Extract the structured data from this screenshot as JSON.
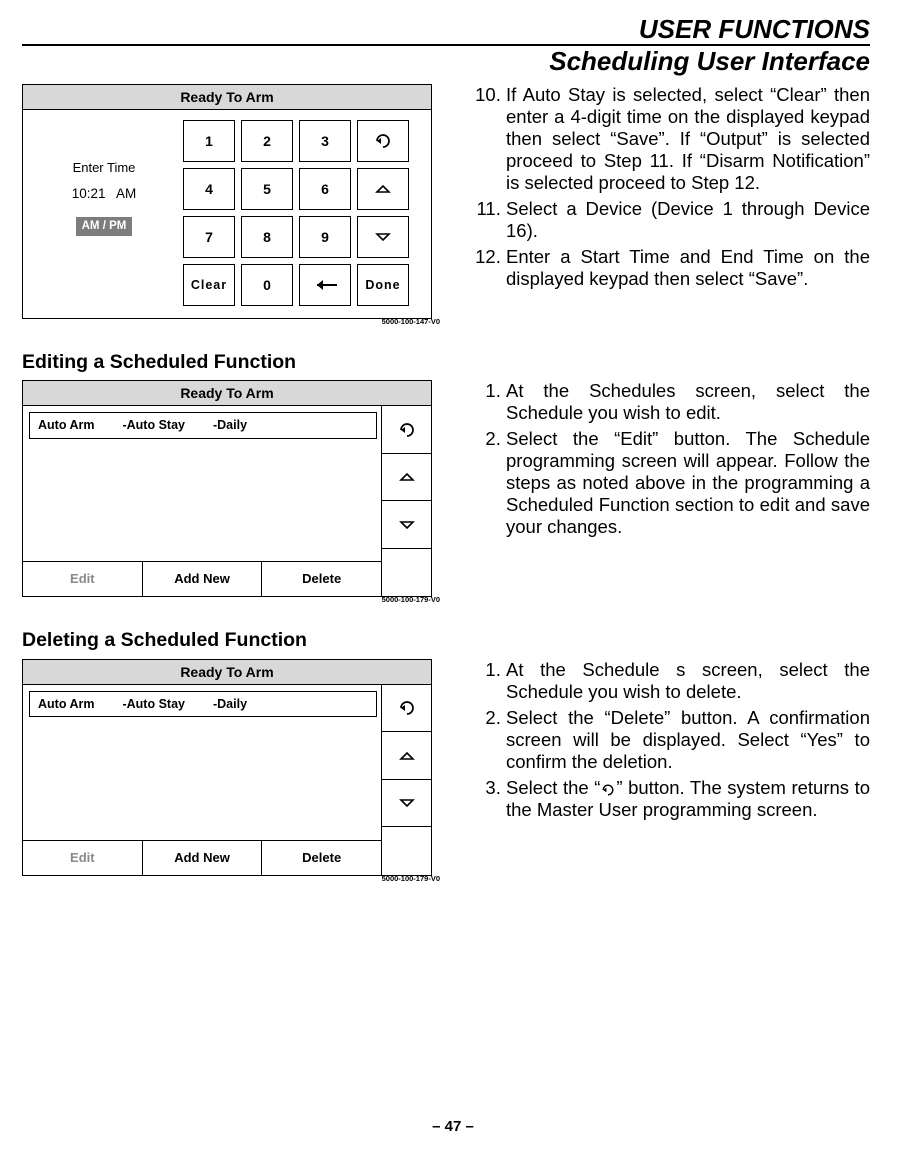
{
  "header": {
    "line1": "USER FUNCTIONS",
    "line2": "Scheduling User Interface"
  },
  "keypad1": {
    "title": "Ready To Arm",
    "enter": "Enter Time",
    "time_value": "10:21",
    "time_ampm": "AM",
    "ampm_button": "AM / PM",
    "keys": {
      "k1": "1",
      "k2": "2",
      "k3": "3",
      "k4": "4",
      "k5": "5",
      "k6": "6",
      "k7": "7",
      "k8": "8",
      "k9": "9",
      "k0": "0",
      "clear": "Clear",
      "done": "Done"
    },
    "footnote": "5000-100-147-V0"
  },
  "sectionEdit": {
    "title": "Editing a Scheduled Function",
    "panel_title": "Ready To Arm",
    "row": {
      "c1": "Auto Arm",
      "c2": "-Auto Stay",
      "c3": "-Daily"
    },
    "btns": {
      "edit": "Edit",
      "add": "Add New",
      "del": "Delete"
    },
    "footnote": "5000-100-179-V0"
  },
  "sectionDel": {
    "title": "Deleting a Scheduled Function",
    "panel_title": "Ready To Arm",
    "row": {
      "c1": "Auto Arm",
      "c2": "-Auto Stay",
      "c3": "-Daily"
    },
    "btns": {
      "edit": "Edit",
      "add": "Add New",
      "del": "Delete"
    },
    "footnote": "5000-100-179-V0"
  },
  "steps_top": {
    "p10": "If Auto Stay is selected, select “Clear” then enter a 4-digit time on the displayed keypad then select “Save”. If “Output” is selected proceed to Step 11. If “Disarm Notification” is selected proceed to Step 12.",
    "p11": "Select a Device (Device 1 through Device 16).",
    "p12": "Enter a Start Time and End Time on the displayed keypad then select “Save”."
  },
  "steps_edit": {
    "p1": "At the Schedules screen, select the Schedule you wish to edit.",
    "p2": "Select the “Edit” button. The Schedule programming screen will appear. Follow the steps as noted above in the programming a Scheduled Function section to edit and save your changes."
  },
  "steps_del": {
    "p1": "At the Schedule s screen, select the Schedule you wish to delete.",
    "p2": "Select the “Delete” button. A confirmation screen will be displayed. Select “Yes” to confirm the deletion.",
    "p3_a": "Select the “",
    "p3_b": "” button. The system returns to the Master User programming screen."
  },
  "footer": "– 47 –"
}
